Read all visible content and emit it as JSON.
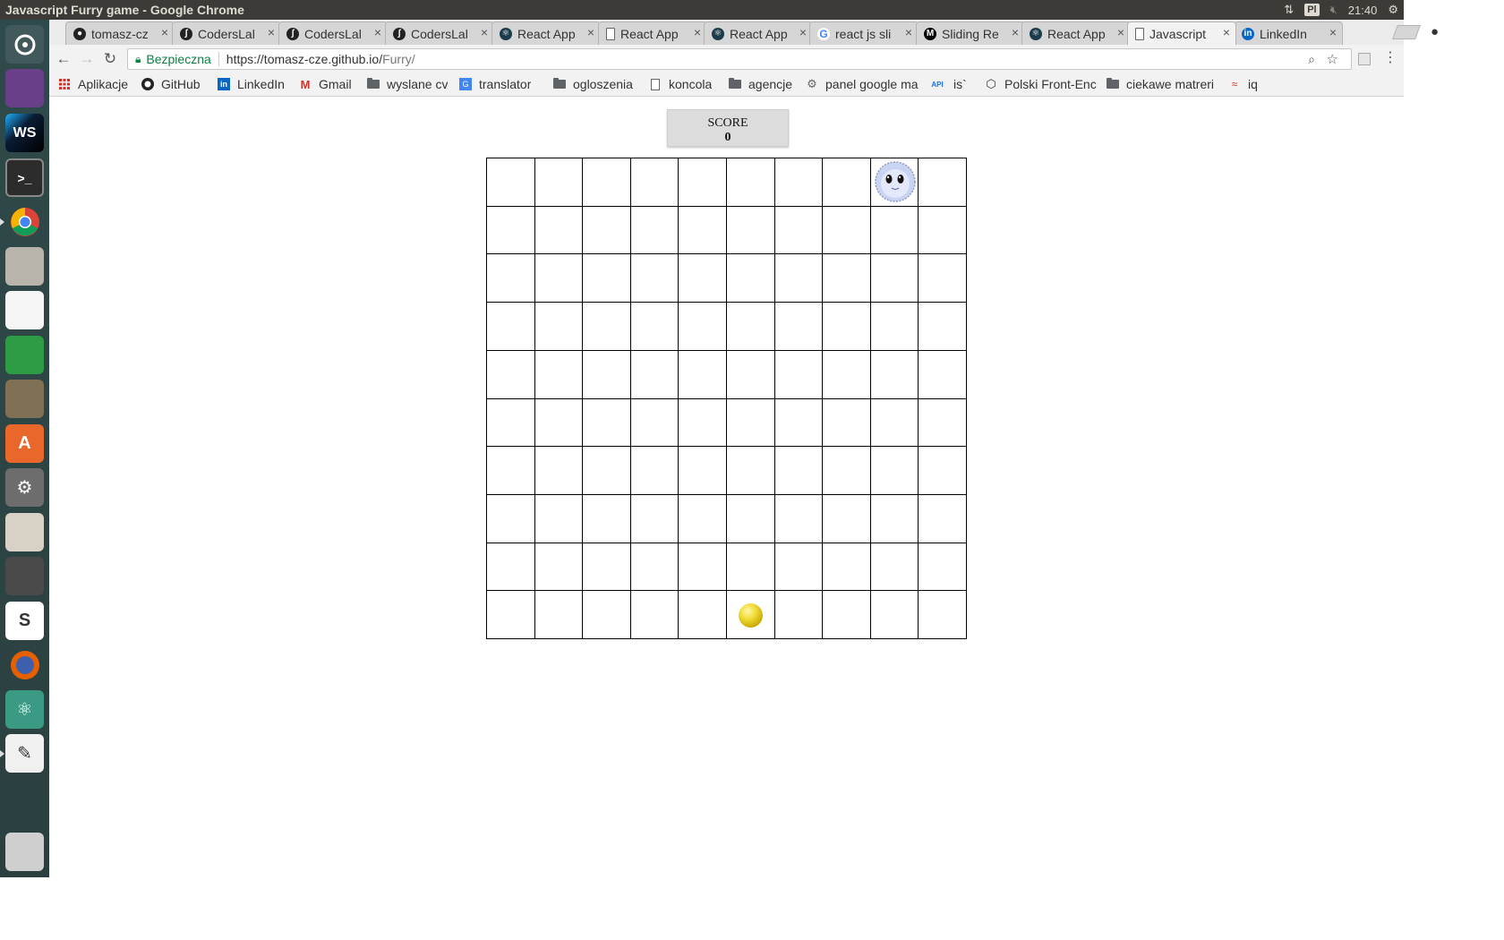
{
  "system": {
    "window_title": "Javascript Furry game - Google Chrome",
    "keyboard_layout": "Pl",
    "clock": "21:40"
  },
  "tabs": [
    {
      "label": "tomasz-cz",
      "icon": "github-icon"
    },
    {
      "label": "CodersLal",
      "icon": "symfony-icon"
    },
    {
      "label": "CodersLal",
      "icon": "symfony-icon"
    },
    {
      "label": "CodersLal",
      "icon": "symfony-icon"
    },
    {
      "label": "React App",
      "icon": "react-icon"
    },
    {
      "label": "React App",
      "icon": "page-icon"
    },
    {
      "label": "React App",
      "icon": "react-icon"
    },
    {
      "label": "react js sli",
      "icon": "google-icon"
    },
    {
      "label": "Sliding Re",
      "icon": "medium-icon"
    },
    {
      "label": "React App",
      "icon": "react-icon"
    },
    {
      "label": "Javascript",
      "icon": "page-icon",
      "active": true
    },
    {
      "label": "LinkedIn",
      "icon": "linkedin-icon"
    }
  ],
  "address_bar": {
    "secure_label": "Bezpieczna",
    "url_host": "https://tomasz-cze.github.io/",
    "url_path": "Furry/"
  },
  "bookmarks": [
    {
      "label": "Aplikacje",
      "icon": "apps-grid-icon"
    },
    {
      "label": "GitHub",
      "icon": "github-icon"
    },
    {
      "label": "LinkedIn",
      "icon": "linkedin-icon"
    },
    {
      "label": "Gmail",
      "icon": "gmail-icon"
    },
    {
      "label": "wyslane cv",
      "icon": "folder-icon"
    },
    {
      "label": "translator",
      "icon": "translate-icon"
    },
    {
      "label": "ogloszenia",
      "icon": "folder-icon"
    },
    {
      "label": "koncola",
      "icon": "page-icon"
    },
    {
      "label": "agencje",
      "icon": "folder-icon"
    },
    {
      "label": "panel google ma",
      "icon": "gear-icon"
    },
    {
      "label": "is`",
      "icon": "api-icon"
    },
    {
      "label": "Polski Front-Enc",
      "icon": "hexagon-icon"
    },
    {
      "label": "ciekawe matreri",
      "icon": "folder-icon"
    },
    {
      "label": "iq",
      "icon": "iq-icon"
    }
  ],
  "game": {
    "score_label": "SCORE",
    "score": "0",
    "grid_columns": 10,
    "grid_rows": 10,
    "furry_cell": {
      "row": 0,
      "col": 8
    },
    "coin_cell": {
      "row": 9,
      "col": 5
    }
  },
  "colors": {
    "launcher_bg": "#2f4a4a",
    "panel_bg": "#3c3b37",
    "secure_green": "#0b8043",
    "coin": "#e6cc2a",
    "furry": "#c9d4f2"
  }
}
